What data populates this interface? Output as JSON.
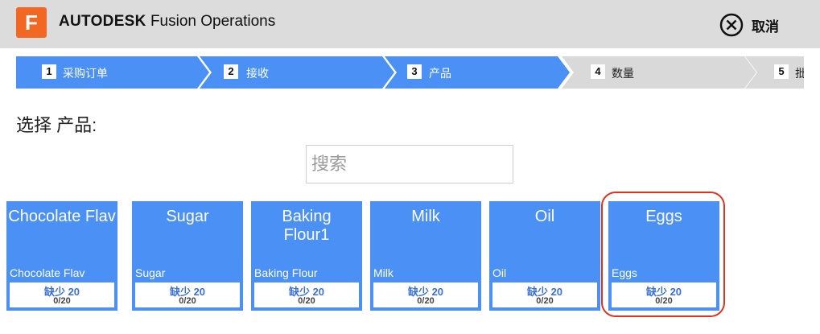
{
  "header": {
    "logo_letter": "F",
    "brand": "AUTODESK",
    "product": "Fusion Operations",
    "cancel_label": "取消",
    "cancel_icon": "close-circle-icon",
    "logo_color": "#f26722"
  },
  "steps": [
    {
      "num": "1",
      "label": "采购订单",
      "active": true
    },
    {
      "num": "2",
      "label": "接收",
      "active": true
    },
    {
      "num": "3",
      "label": "产品",
      "active": true
    },
    {
      "num": "4",
      "label": "数量",
      "active": false
    },
    {
      "num": "5",
      "label": "批",
      "active": false
    }
  ],
  "heading": "选择 产品:",
  "search": {
    "placeholder": "搜索",
    "value": ""
  },
  "colors": {
    "accent": "#4a90f5",
    "inactive_step": "#d9d9d9",
    "highlight": "#e0301e"
  },
  "products": [
    {
      "title": "Chocolate Flav",
      "subtitle": "Chocolate Flav",
      "shortage": "缺少 20",
      "count": "0/20"
    },
    {
      "title": "Sugar",
      "subtitle": "Sugar",
      "shortage": "缺少 20",
      "count": "0/20"
    },
    {
      "title": "Baking Flour1",
      "subtitle": "Baking Flour",
      "shortage": "缺少 20",
      "count": "0/20"
    },
    {
      "title": "Milk",
      "subtitle": "Milk",
      "shortage": "缺少 20",
      "count": "0/20"
    },
    {
      "title": "Oil",
      "subtitle": "Oil",
      "shortage": "缺少 20",
      "count": "0/20"
    },
    {
      "title": "Eggs",
      "subtitle": "Eggs",
      "shortage": "缺少 20",
      "count": "0/20"
    }
  ]
}
